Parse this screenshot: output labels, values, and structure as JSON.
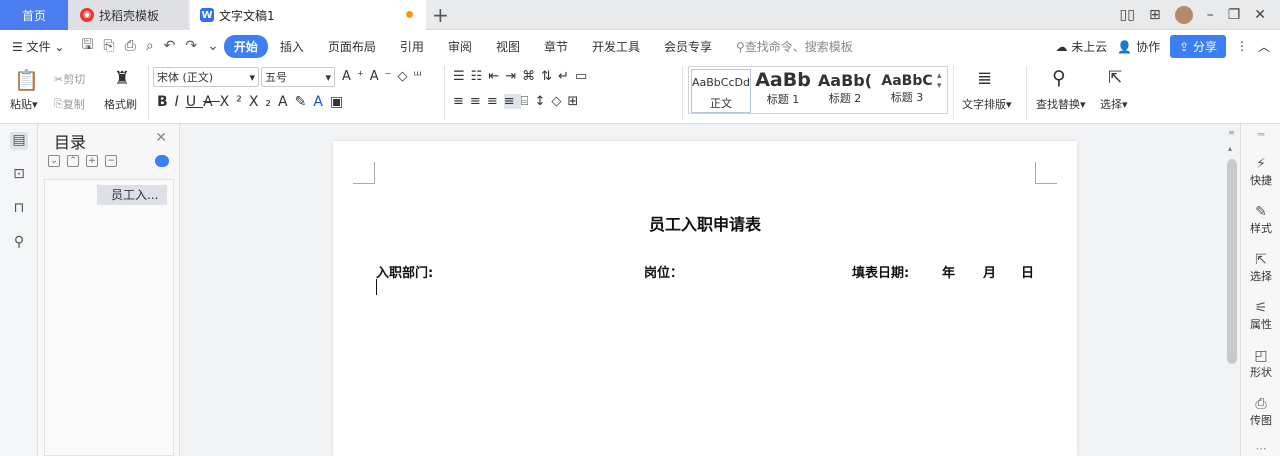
{
  "tabs": {
    "home": "首页",
    "template": "找稻壳模板",
    "doc": "文字文稿1",
    "add": "+"
  },
  "window_controls": {
    "minimize": "–",
    "restore": "❐",
    "close": "✕"
  },
  "menu": {
    "file": "文件",
    "items": [
      "开始",
      "插入",
      "页面布局",
      "引用",
      "审阅",
      "视图",
      "章节",
      "开发工具",
      "会员专享"
    ],
    "search": "查找命令、搜索模板",
    "cloud": "未上云",
    "cooperate": "协作",
    "share": "分享"
  },
  "ribbon": {
    "paste": "粘贴",
    "cut": "剪切",
    "copy": "复制",
    "format_painter": "格式刷",
    "font_name": "宋体 (正文)",
    "font_size": "五号",
    "styles": [
      {
        "preview": "AaBbCcDd",
        "label": "正文"
      },
      {
        "preview": "AaBb",
        "label": "标题 1"
      },
      {
        "preview": "AaBb(",
        "label": "标题 2"
      },
      {
        "preview": "AaBbC",
        "label": "标题 3"
      }
    ],
    "text_layout": "文字排版",
    "find_replace": "查找替换",
    "select": "选择"
  },
  "toc": {
    "title": "目录",
    "item": "员工入..."
  },
  "document": {
    "title": "员工入职申请表",
    "dept": "入职部门:",
    "position": "岗位：",
    "date": "填表日期:",
    "year": "年",
    "month": "月",
    "day": "日"
  },
  "right_panel": [
    "快捷",
    "样式",
    "选择",
    "属性",
    "形状",
    "传图"
  ],
  "colors": {
    "accent": "#3c7ef3",
    "modified_dot": "#f39c12"
  }
}
